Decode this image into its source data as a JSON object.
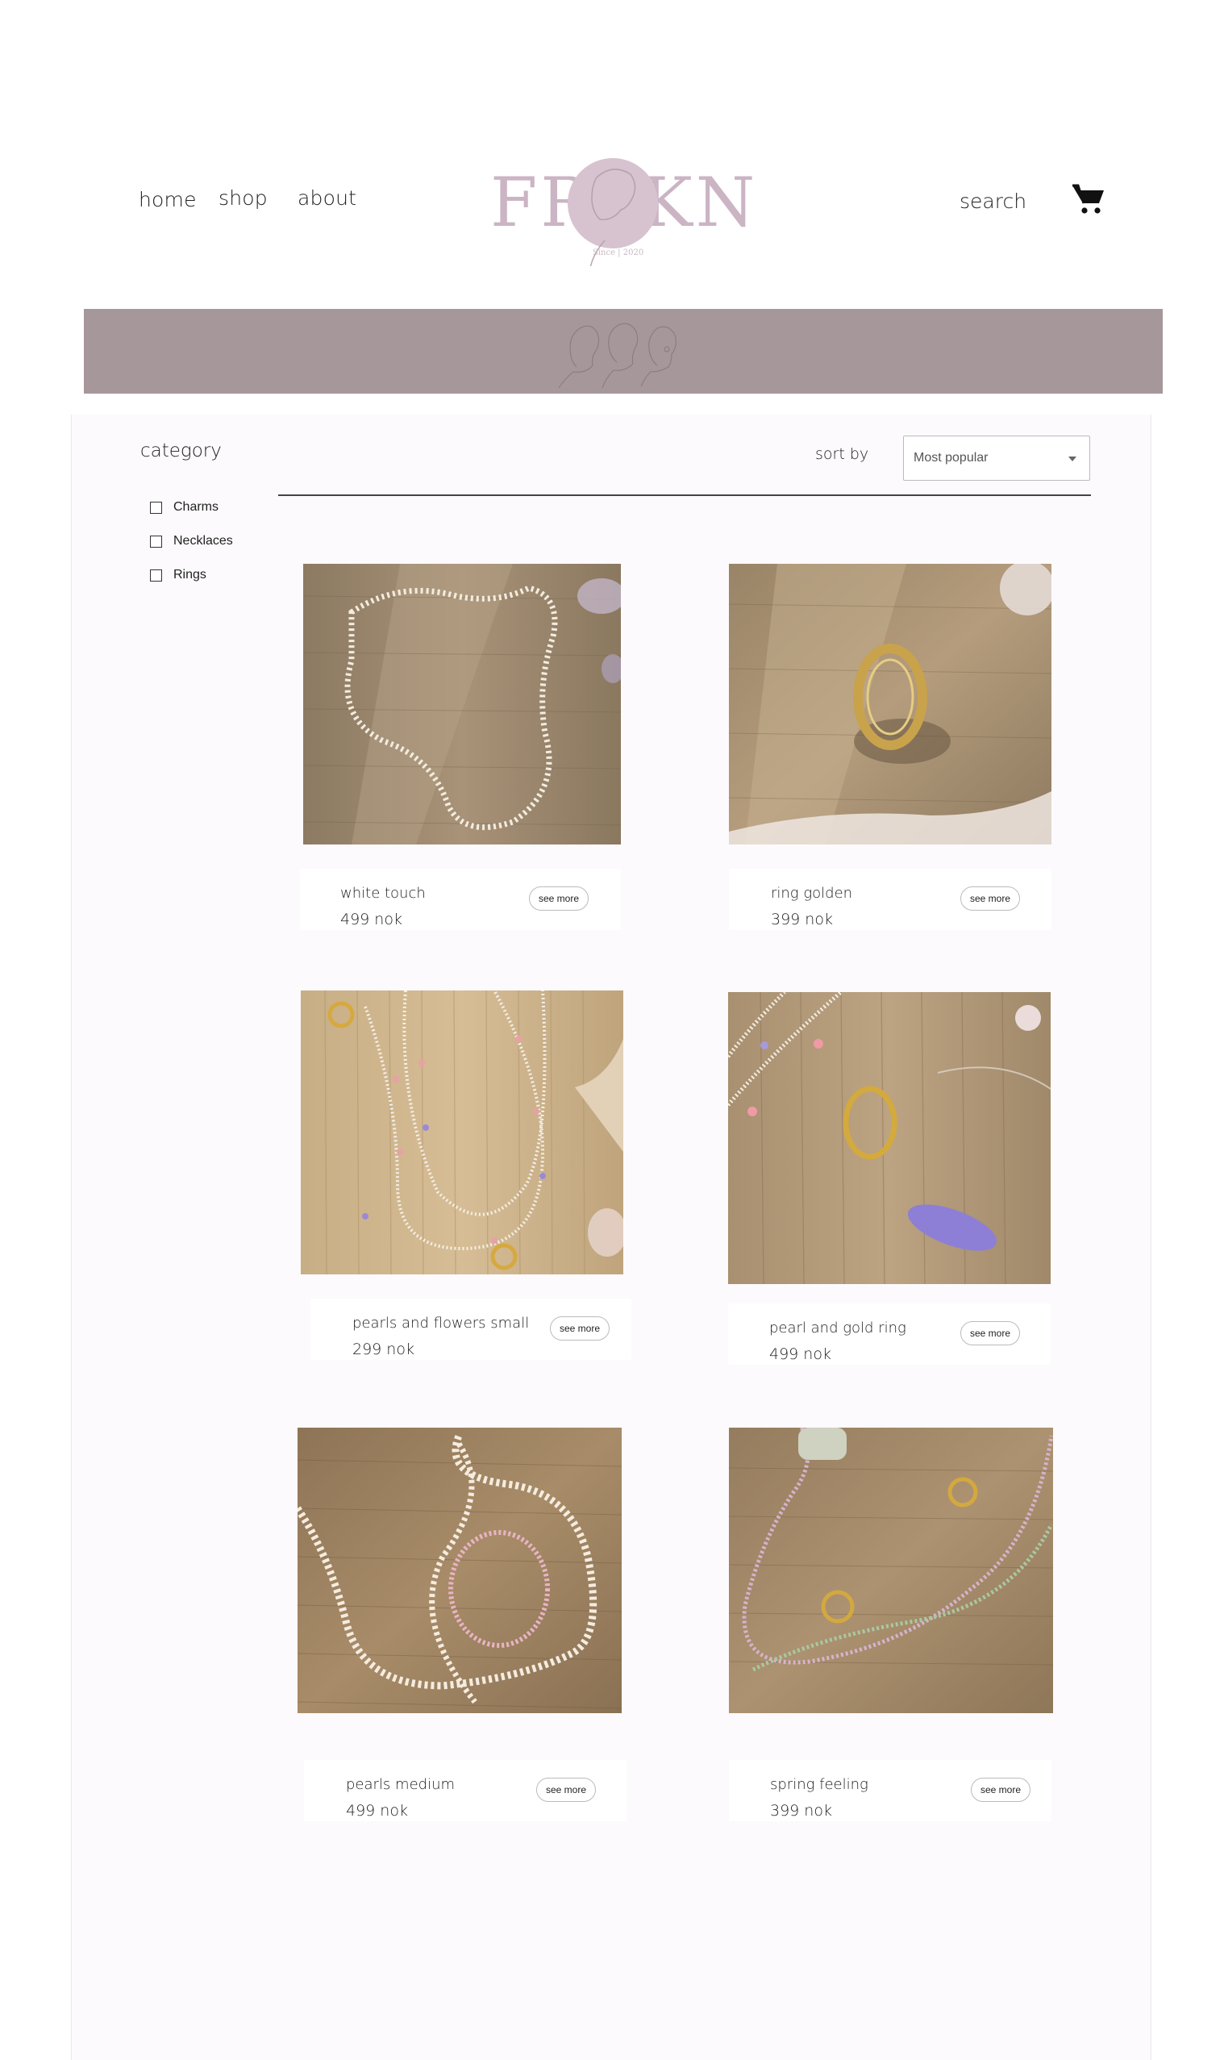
{
  "nav": {
    "home": "home",
    "shop": "shop",
    "about": "about",
    "search": "search"
  },
  "logo": {
    "brand": "FROKN",
    "tagline": "Since | 2020",
    "color": "#cbb4c4"
  },
  "colors": {
    "banner": "#a6979a",
    "panel": "#fcfafc"
  },
  "filters": {
    "title": "category",
    "items": [
      {
        "label": "Charms",
        "checked": false
      },
      {
        "label": "Necklaces",
        "checked": false
      },
      {
        "label": "Rings",
        "checked": false
      }
    ]
  },
  "sort": {
    "label": "sort by",
    "selected": "Most popular"
  },
  "products": [
    {
      "name": "white touch",
      "price": "499 nok",
      "button": "see more"
    },
    {
      "name": "ring golden",
      "price": "399 nok",
      "button": "see more"
    },
    {
      "name": "pearls and flowers small",
      "price": "299 nok",
      "button": "see more"
    },
    {
      "name": "pearl and gold ring",
      "price": "499 nok",
      "button": "see more"
    },
    {
      "name": "pearls medium",
      "price": "499 nok",
      "button": "see more"
    },
    {
      "name": "spring feeling",
      "price": "399 nok",
      "button": "see more"
    }
  ]
}
